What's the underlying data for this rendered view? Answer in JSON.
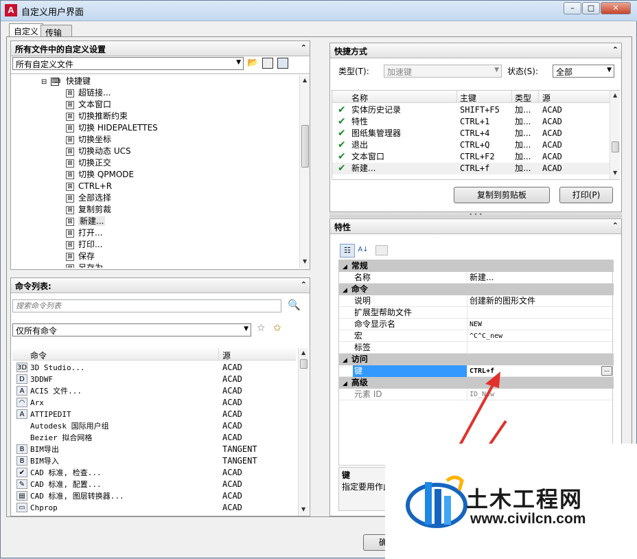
{
  "window": {
    "title": "自定义用户界面",
    "app_icon_letter": "A"
  },
  "window_buttons": {
    "minimize": "–",
    "maximize": "□",
    "close": "✕"
  },
  "tabs": [
    {
      "label": "自定义"
    },
    {
      "label": "传输"
    }
  ],
  "left_top": {
    "header": "所有文件中的自定义设置",
    "file_combo": "所有自定义文件",
    "tree_parent": "快捷键",
    "tree_items": [
      "超链接...",
      "文本窗口",
      "切换推断约束",
      "切换 HIDEPALETTES",
      "切换坐标",
      "切换动态 UCS",
      "切换正交",
      "切换 QPMODE",
      "CTRL+R",
      "全部选择",
      "复制剪裁",
      "新建...",
      "打开...",
      "打印...",
      "保存",
      "另存为..."
    ]
  },
  "command_list": {
    "header": "命令列表:",
    "search_placeholder": "搜索命令列表",
    "filter_combo": "仅所有命令",
    "columns": [
      "命令",
      "源"
    ],
    "rows": [
      {
        "icon": "3D",
        "name": "3D Studio...",
        "source": "ACAD"
      },
      {
        "icon": "D",
        "name": "3DDWF",
        "source": "ACAD"
      },
      {
        "icon": "A",
        "name": "ACIS 文件...",
        "source": "ACAD"
      },
      {
        "icon": "◠",
        "name": "Arx",
        "source": "ACAD"
      },
      {
        "icon": "A",
        "name": "ATTIPEDIT",
        "source": "ACAD"
      },
      {
        "icon": "",
        "name": "Autodesk 国际用户组",
        "source": "ACAD"
      },
      {
        "icon": "",
        "name": "Bezier 拟合网格",
        "source": "ACAD"
      },
      {
        "icon": "B",
        "name": "BIM导出",
        "source": "TANGENT"
      },
      {
        "icon": "B",
        "name": "BIM导入",
        "source": "TANGENT"
      },
      {
        "icon": "✔",
        "name": "CAD 标准, 检查...",
        "source": "ACAD"
      },
      {
        "icon": "✎",
        "name": "CAD 标准, 配置...",
        "source": "ACAD"
      },
      {
        "icon": "▤",
        "name": "CAD 标准, 图层转换器...",
        "source": "ACAD"
      },
      {
        "icon": "▭",
        "name": "Chprop",
        "source": "ACAD"
      }
    ]
  },
  "shortcuts": {
    "header": "快捷方式",
    "type_label": "类型(T):",
    "type_value": "加速键",
    "status_label": "状态(S):",
    "status_value": "全部",
    "columns": [
      "名称",
      "主键",
      "类型",
      "源"
    ],
    "rows": [
      {
        "name": "实体历史记录",
        "key": "SHIFT+F5",
        "type": "加...",
        "source": "ACAD"
      },
      {
        "name": "特性",
        "key": "CTRL+1",
        "type": "加...",
        "source": "ACAD"
      },
      {
        "name": "图纸集管理器",
        "key": "CTRL+4",
        "type": "加...",
        "source": "ACAD"
      },
      {
        "name": "退出",
        "key": "CTRL+Q",
        "type": "加...",
        "source": "ACAD"
      },
      {
        "name": "文本窗口",
        "key": "CTRL+F2",
        "type": "加...",
        "source": "ACAD"
      },
      {
        "name": "新建...",
        "key": "CTRL+f",
        "type": "加...",
        "source": "ACAD"
      }
    ],
    "copy_button": "复制到剪贴板",
    "print_button": "打印(P)"
  },
  "properties": {
    "header": "特性",
    "categories": {
      "general": "常规",
      "command": "命令",
      "access": "访问",
      "advanced": "高级"
    },
    "general_rows": [
      {
        "key": "名称",
        "value": "新建..."
      }
    ],
    "command_rows": [
      {
        "key": "说明",
        "value": "创建新的图形文件"
      },
      {
        "key": "扩展型帮助文件",
        "value": ""
      },
      {
        "key": "命令显示名",
        "value": "NEW"
      },
      {
        "key": "宏",
        "value": "^C^C_new"
      },
      {
        "key": "标签",
        "value": ""
      }
    ],
    "access_row": {
      "key": "键",
      "value": "CTRL+f",
      "button": "..."
    },
    "advanced_row": {
      "key": "元素 ID",
      "value": "ID_New"
    },
    "desc_title": "键",
    "desc_text": "指定要用作此"
  },
  "bottom": {
    "ok_button": "确定"
  },
  "watermark": {
    "name": "土木工程网",
    "url": "www.civilcn.com"
  },
  "colors": {
    "selection": "#3399ff",
    "check": "#1b8a2b",
    "arrow": "#e0322b",
    "watermark_blue": "#1565c0"
  }
}
